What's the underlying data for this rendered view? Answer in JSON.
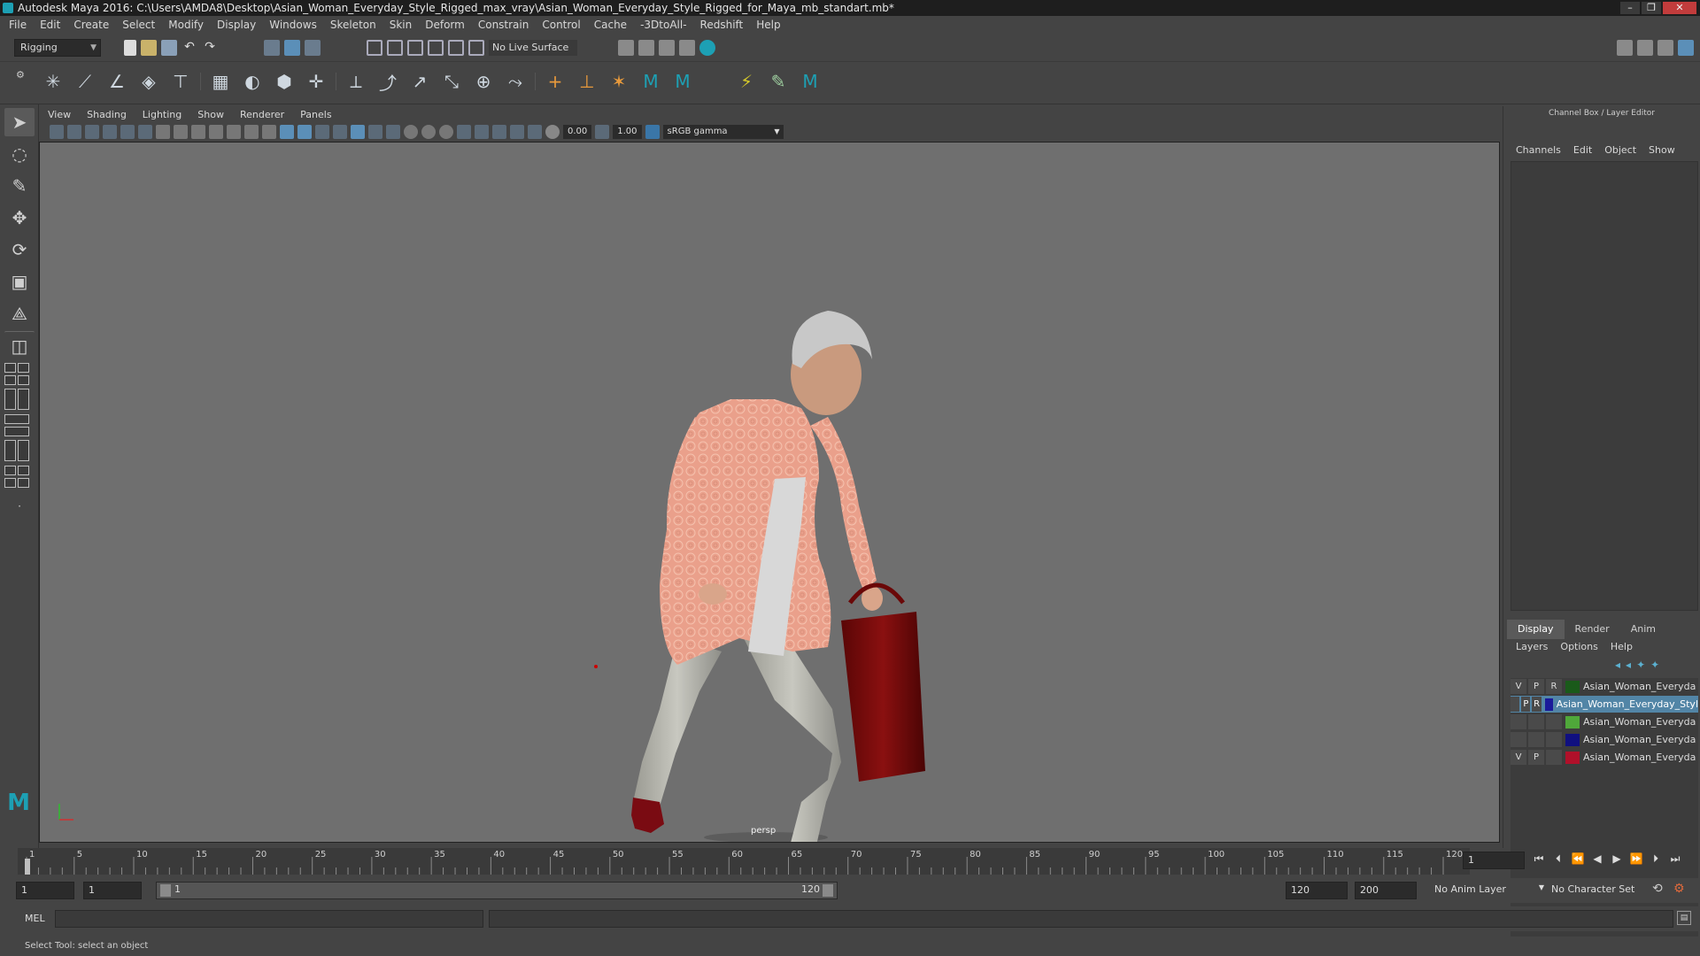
{
  "window": {
    "title": "Autodesk Maya 2016: C:\\Users\\AMDA8\\Desktop\\Asian_Woman_Everyday_Style_Rigged_max_vray\\Asian_Woman_Everyday_Style_Rigged_for_Maya_mb_standart.mb*",
    "controls": [
      "–",
      "❐",
      "✕"
    ]
  },
  "menubar": [
    "File",
    "Edit",
    "Create",
    "Select",
    "Modify",
    "Display",
    "Windows",
    "Skeleton",
    "Skin",
    "Deform",
    "Constrain",
    "Control",
    "Cache",
    "-3DtoAll-",
    "Redshift",
    "Help"
  ],
  "statusline": {
    "menuset": "Rigging",
    "live_surface": "No Live Surface"
  },
  "viewport": {
    "menu": [
      "View",
      "Shading",
      "Lighting",
      "Show",
      "Renderer",
      "Panels"
    ],
    "exposure": "0.00",
    "gamma": "1.00",
    "color_space": "sRGB gamma",
    "camera": "persp"
  },
  "right_panel": {
    "title": "Channel Box / Layer Editor",
    "menu": [
      "Channels",
      "Edit",
      "Object",
      "Show"
    ],
    "tabs": [
      "Display",
      "Render",
      "Anim"
    ],
    "active_tab": "Display",
    "layer_menu": [
      "Layers",
      "Options",
      "Help"
    ],
    "layers": [
      {
        "v": "V",
        "p": "P",
        "r": "R",
        "color": "#1a5a1a",
        "name": "Asian_Woman_Everyda",
        "selected": false
      },
      {
        "v": "",
        "p": "P",
        "r": "R",
        "color": "#1a1a9a",
        "name": "Asian_Woman_Everyday_Styl",
        "selected": true
      },
      {
        "v": "",
        "p": "",
        "r": "",
        "color": "#4fa83a",
        "name": "Asian_Woman_Everyda",
        "selected": false
      },
      {
        "v": "",
        "p": "",
        "r": "",
        "color": "#101080",
        "name": "Asian_Woman_Everyda",
        "selected": false
      },
      {
        "v": "V",
        "p": "P",
        "r": "",
        "color": "#b0102a",
        "name": "Asian_Woman_Everyda",
        "selected": false
      }
    ]
  },
  "timeline": {
    "ticks": [
      "1",
      "5",
      "10",
      "15",
      "20",
      "25",
      "30",
      "35",
      "40",
      "45",
      "50",
      "55",
      "60",
      "65",
      "70",
      "75",
      "80",
      "85",
      "90",
      "95",
      "100",
      "105",
      "110",
      "115",
      "120"
    ],
    "current_frame": "1"
  },
  "range": {
    "start": "1",
    "playback_start": "1",
    "slider_start": "1",
    "slider_end": "120",
    "playback_end": "120",
    "end": "200",
    "anim_layer": "No Anim Layer",
    "char_set": "No Character Set"
  },
  "cmdline": {
    "label": "MEL"
  },
  "helpline": {
    "text": "Select Tool: select an object"
  },
  "colors": {
    "accent": "#5285a6",
    "viewport_bg": "#6f6f6f",
    "blouse": "#e8a08a",
    "bag": "#7a0a0a"
  }
}
